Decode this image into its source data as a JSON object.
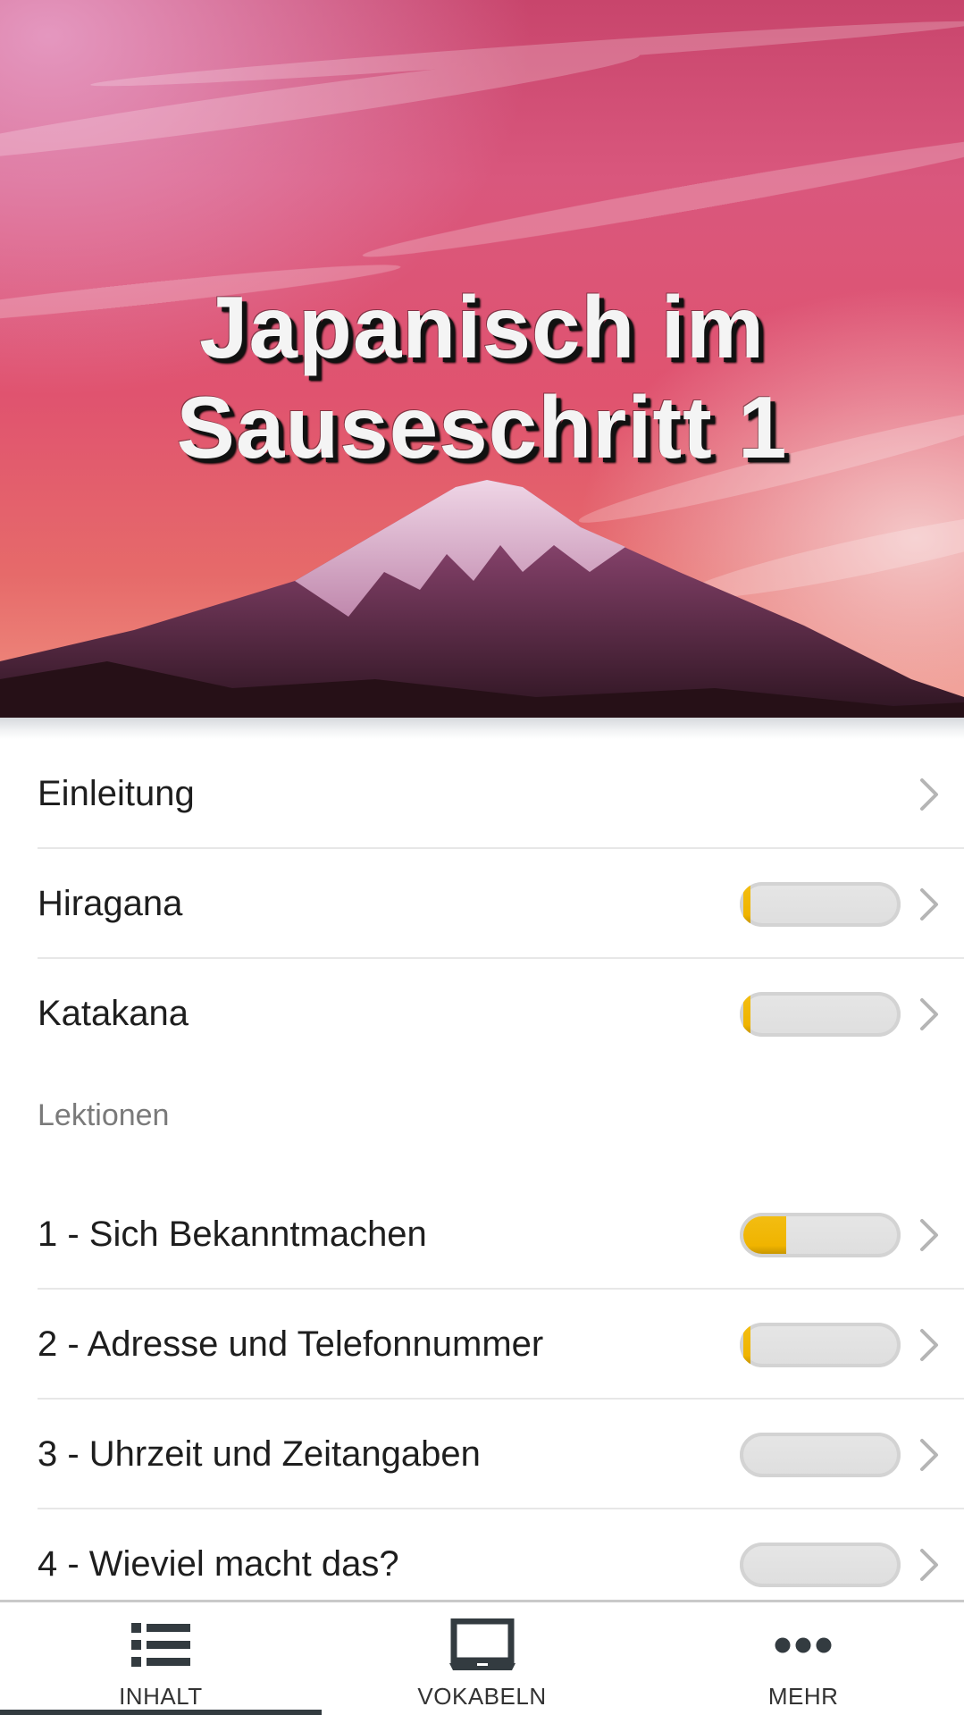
{
  "header": {
    "title_line1": "Japanisch im",
    "title_line2": "Sauseschritt 1"
  },
  "intro_items": [
    {
      "label": "Einleitung",
      "has_progress": false,
      "progress": 0
    },
    {
      "label": "Hiragana",
      "has_progress": true,
      "progress": 0.04
    },
    {
      "label": "Katakana",
      "has_progress": true,
      "progress": 0.02
    }
  ],
  "lessons_section": {
    "title": "Lektionen",
    "items": [
      {
        "label": "1 - Sich Bekanntmachen",
        "progress": 0.28
      },
      {
        "label": "2 - Adresse und Telefonnummer",
        "progress": 0.04
      },
      {
        "label": "3 - Uhrzeit und Zeitangaben",
        "progress": 0
      },
      {
        "label": "4 - Wieviel macht das?",
        "progress": 0
      }
    ]
  },
  "bottom_nav": {
    "items": [
      {
        "label": "INHALT",
        "icon": "list-icon",
        "active": true
      },
      {
        "label": "VOKABELN",
        "icon": "laptop-icon",
        "active": false
      },
      {
        "label": "MEHR",
        "icon": "more-dots-icon",
        "active": false
      }
    ]
  },
  "colors": {
    "progress_fill": "#f0b400",
    "progress_track": "#e2e2e2",
    "nav_active_indicator": "#333b40",
    "sky_top": "#d24f78",
    "mountain": "#3b1d2e"
  }
}
